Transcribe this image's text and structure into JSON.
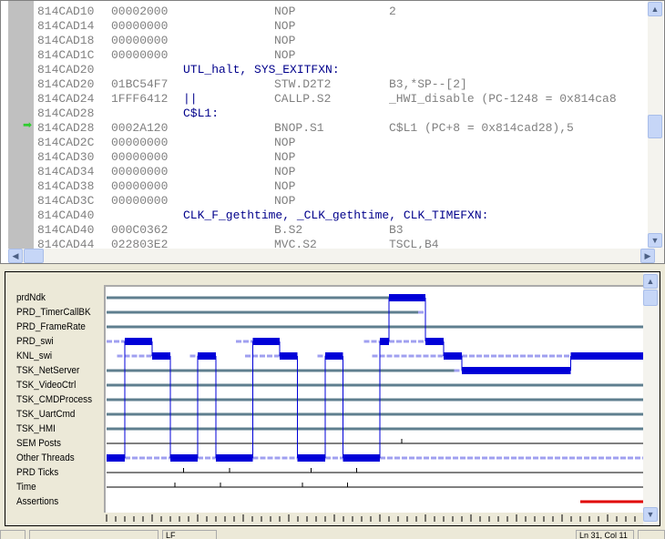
{
  "disassembly": {
    "pc_row": 8,
    "rows": [
      {
        "addr": "814CAD10",
        "op": "00002000",
        "label": "",
        "mn": "NOP",
        "arg": "2"
      },
      {
        "addr": "814CAD14",
        "op": "00000000",
        "label": "",
        "mn": "NOP",
        "arg": ""
      },
      {
        "addr": "814CAD18",
        "op": "00000000",
        "label": "",
        "mn": "NOP",
        "arg": ""
      },
      {
        "addr": "814CAD1C",
        "op": "00000000",
        "label": "",
        "mn": "NOP",
        "arg": ""
      },
      {
        "addr": "814CAD20",
        "op": "",
        "label": "UTL_halt, SYS_EXITFXN:",
        "mn": "",
        "arg": ""
      },
      {
        "addr": "814CAD20",
        "op": "01BC54F7",
        "label": "",
        "mn": "STW.D2T2",
        "arg": "B3,*SP--[2]"
      },
      {
        "addr": "814CAD24",
        "op": "1FFF6412",
        "label": "||",
        "mn": "CALLP.S2",
        "arg": "_HWI_disable (PC-1248 = 0x814ca8"
      },
      {
        "addr": "814CAD28",
        "op": "",
        "label": "C$L1:",
        "mn": "",
        "arg": ""
      },
      {
        "addr": "814CAD28",
        "op": "0002A120",
        "label": "",
        "mn": "BNOP.S1",
        "arg": "C$L1 (PC+8 = 0x814cad28),5"
      },
      {
        "addr": "814CAD2C",
        "op": "00000000",
        "label": "",
        "mn": "NOP",
        "arg": ""
      },
      {
        "addr": "814CAD30",
        "op": "00000000",
        "label": "",
        "mn": "NOP",
        "arg": ""
      },
      {
        "addr": "814CAD34",
        "op": "00000000",
        "label": "",
        "mn": "NOP",
        "arg": ""
      },
      {
        "addr": "814CAD38",
        "op": "00000000",
        "label": "",
        "mn": "NOP",
        "arg": ""
      },
      {
        "addr": "814CAD3C",
        "op": "00000000",
        "label": "",
        "mn": "NOP",
        "arg": ""
      },
      {
        "addr": "814CAD40",
        "op": "",
        "label": "CLK_F_gethtime, _CLK_gethtime, CLK_TIMEFXN:",
        "mn": "",
        "arg": ""
      },
      {
        "addr": "814CAD40",
        "op": "000C0362",
        "label": "",
        "mn": "B.S2",
        "arg": "B3"
      },
      {
        "addr": "814CAD44",
        "op": "022803E2",
        "label": "",
        "mn": "MVC.S2",
        "arg": "TSCL,B4"
      }
    ]
  },
  "execution_graph": {
    "colors": {
      "running": "#0000d8",
      "ready": "#a0a0f0",
      "idle": "#5f7f8f",
      "line": "#000000",
      "assertion": "#e00000"
    },
    "time_range": [
      0,
      11.8
    ],
    "rows": [
      {
        "name": "prdNdk",
        "kind": "thread",
        "segments": [
          [
            0,
            6.2,
            "idle"
          ],
          [
            6.2,
            7.0,
            "running"
          ]
        ]
      },
      {
        "name": "PRD_TimerCallBK",
        "kind": "thread",
        "segments": [
          [
            0,
            6.84,
            "idle"
          ],
          [
            6.84,
            7.0,
            "ready"
          ]
        ]
      },
      {
        "name": "PRD_FrameRate",
        "kind": "thread",
        "segments": [
          [
            0,
            11.8,
            "idle"
          ]
        ]
      },
      {
        "name": "PRD_swi",
        "kind": "thread",
        "segments": [
          [
            0,
            0.4,
            "ready"
          ],
          [
            0.4,
            1.0,
            "running"
          ],
          [
            2.84,
            3.21,
            "ready"
          ],
          [
            3.21,
            3.8,
            "running"
          ],
          [
            5.65,
            6.0,
            "ready"
          ],
          [
            6.0,
            6.2,
            "running"
          ],
          [
            6.2,
            7.0,
            "ready"
          ],
          [
            7.0,
            7.4,
            "running"
          ]
        ]
      },
      {
        "name": "KNL_swi",
        "kind": "thread",
        "segments": [
          [
            0.23,
            1.0,
            "ready"
          ],
          [
            1.0,
            1.4,
            "running"
          ],
          [
            1.83,
            2.0,
            "ready"
          ],
          [
            2.0,
            2.4,
            "running"
          ],
          [
            3.04,
            3.8,
            "ready"
          ],
          [
            3.8,
            4.19,
            "running"
          ],
          [
            4.63,
            4.8,
            "ready"
          ],
          [
            4.8,
            5.19,
            "running"
          ],
          [
            5.83,
            7.4,
            "ready"
          ],
          [
            7.4,
            7.8,
            "running"
          ],
          [
            7.8,
            10.19,
            "ready"
          ],
          [
            10.19,
            11.8,
            "running"
          ]
        ]
      },
      {
        "name": "TSK_NetServer",
        "kind": "thread",
        "segments": [
          [
            0,
            7.63,
            "idle"
          ],
          [
            7.63,
            7.8,
            "ready"
          ],
          [
            7.8,
            10.19,
            "running"
          ]
        ]
      },
      {
        "name": "TSK_VideoCtrl",
        "kind": "thread",
        "segments": [
          [
            0,
            11.8,
            "idle"
          ]
        ]
      },
      {
        "name": "TSK_CMDProcess",
        "kind": "thread",
        "segments": [
          [
            0,
            11.8,
            "idle"
          ]
        ]
      },
      {
        "name": "TSK_UartCmd",
        "kind": "thread",
        "segments": [
          [
            0,
            11.8,
            "idle"
          ]
        ]
      },
      {
        "name": "TSK_HMI",
        "kind": "thread",
        "segments": [
          [
            0,
            11.8,
            "idle"
          ]
        ]
      },
      {
        "name": "SEM Posts",
        "kind": "events",
        "events": [
          6.48
        ]
      },
      {
        "name": "Other Threads",
        "kind": "thread",
        "segments": [
          [
            0,
            0.4,
            "running"
          ],
          [
            0.4,
            1.4,
            "ready"
          ],
          [
            1.4,
            2.0,
            "running"
          ],
          [
            2.0,
            2.4,
            "ready"
          ],
          [
            2.4,
            3.21,
            "running"
          ],
          [
            3.21,
            4.19,
            "ready"
          ],
          [
            4.19,
            4.8,
            "running"
          ],
          [
            4.8,
            5.19,
            "ready"
          ],
          [
            5.19,
            6.0,
            "running"
          ],
          [
            6.0,
            11.8,
            "ready"
          ]
        ]
      },
      {
        "name": "PRD Ticks",
        "kind": "events",
        "events": [
          1.69,
          2.7,
          4.49,
          5.49
        ]
      },
      {
        "name": "Time",
        "kind": "events",
        "events": [
          1.5,
          2.5,
          4.3,
          5.29
        ]
      },
      {
        "name": "Assertions",
        "kind": "assert",
        "segments": [
          [
            10.4,
            11.8
          ]
        ]
      }
    ]
  },
  "status": {
    "eol": "LF",
    "position": "Ln 31, Col 11"
  }
}
